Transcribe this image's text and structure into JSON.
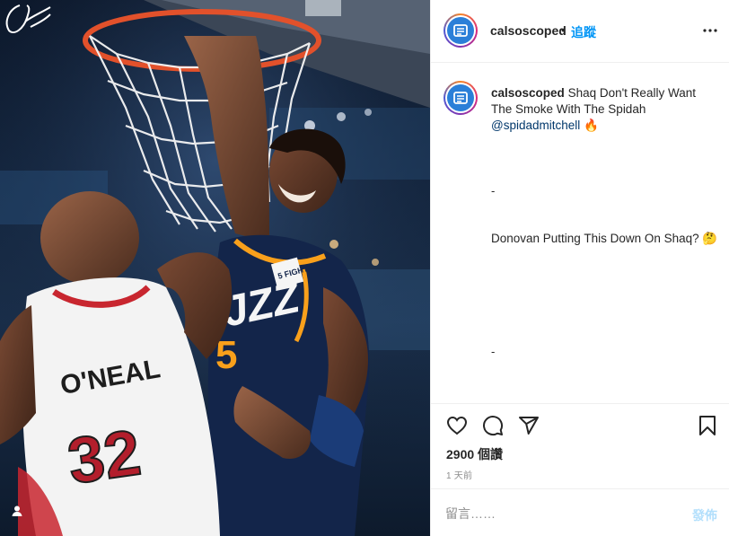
{
  "post": {
    "username": "calsoscoped",
    "separator": "•",
    "follow_label": "追蹤",
    "caption_part1": "Shaq Don't Really Want The Smoke With The Spidah",
    "mention": "@spidadmitchell",
    "emoji_fire": "🔥",
    "dash1": "-",
    "caption_part2": "Donovan Putting This Down On Shaq?",
    "emoji_thinking": "🤔",
    "dash2": "-",
    "likes": "2900 個讚",
    "time_ago": "1 天前",
    "comment_placeholder": "留言……",
    "post_label": "發佈"
  },
  "image": {
    "jersey_name": "O'NEAL",
    "jersey_number": "32",
    "patch_text": "5 for the FIGHT"
  },
  "icons": {
    "header_more": "more-horiz-icon",
    "like": "heart-icon",
    "comment": "comment-icon",
    "share": "paper-plane-icon",
    "save": "bookmark-icon",
    "user_tag": "user-icon"
  },
  "colors": {
    "accent": "#0095f6",
    "post_disabled": "#b2dffc",
    "mention": "#00376b",
    "muted": "#8e8e8e",
    "border": "#efefef"
  }
}
